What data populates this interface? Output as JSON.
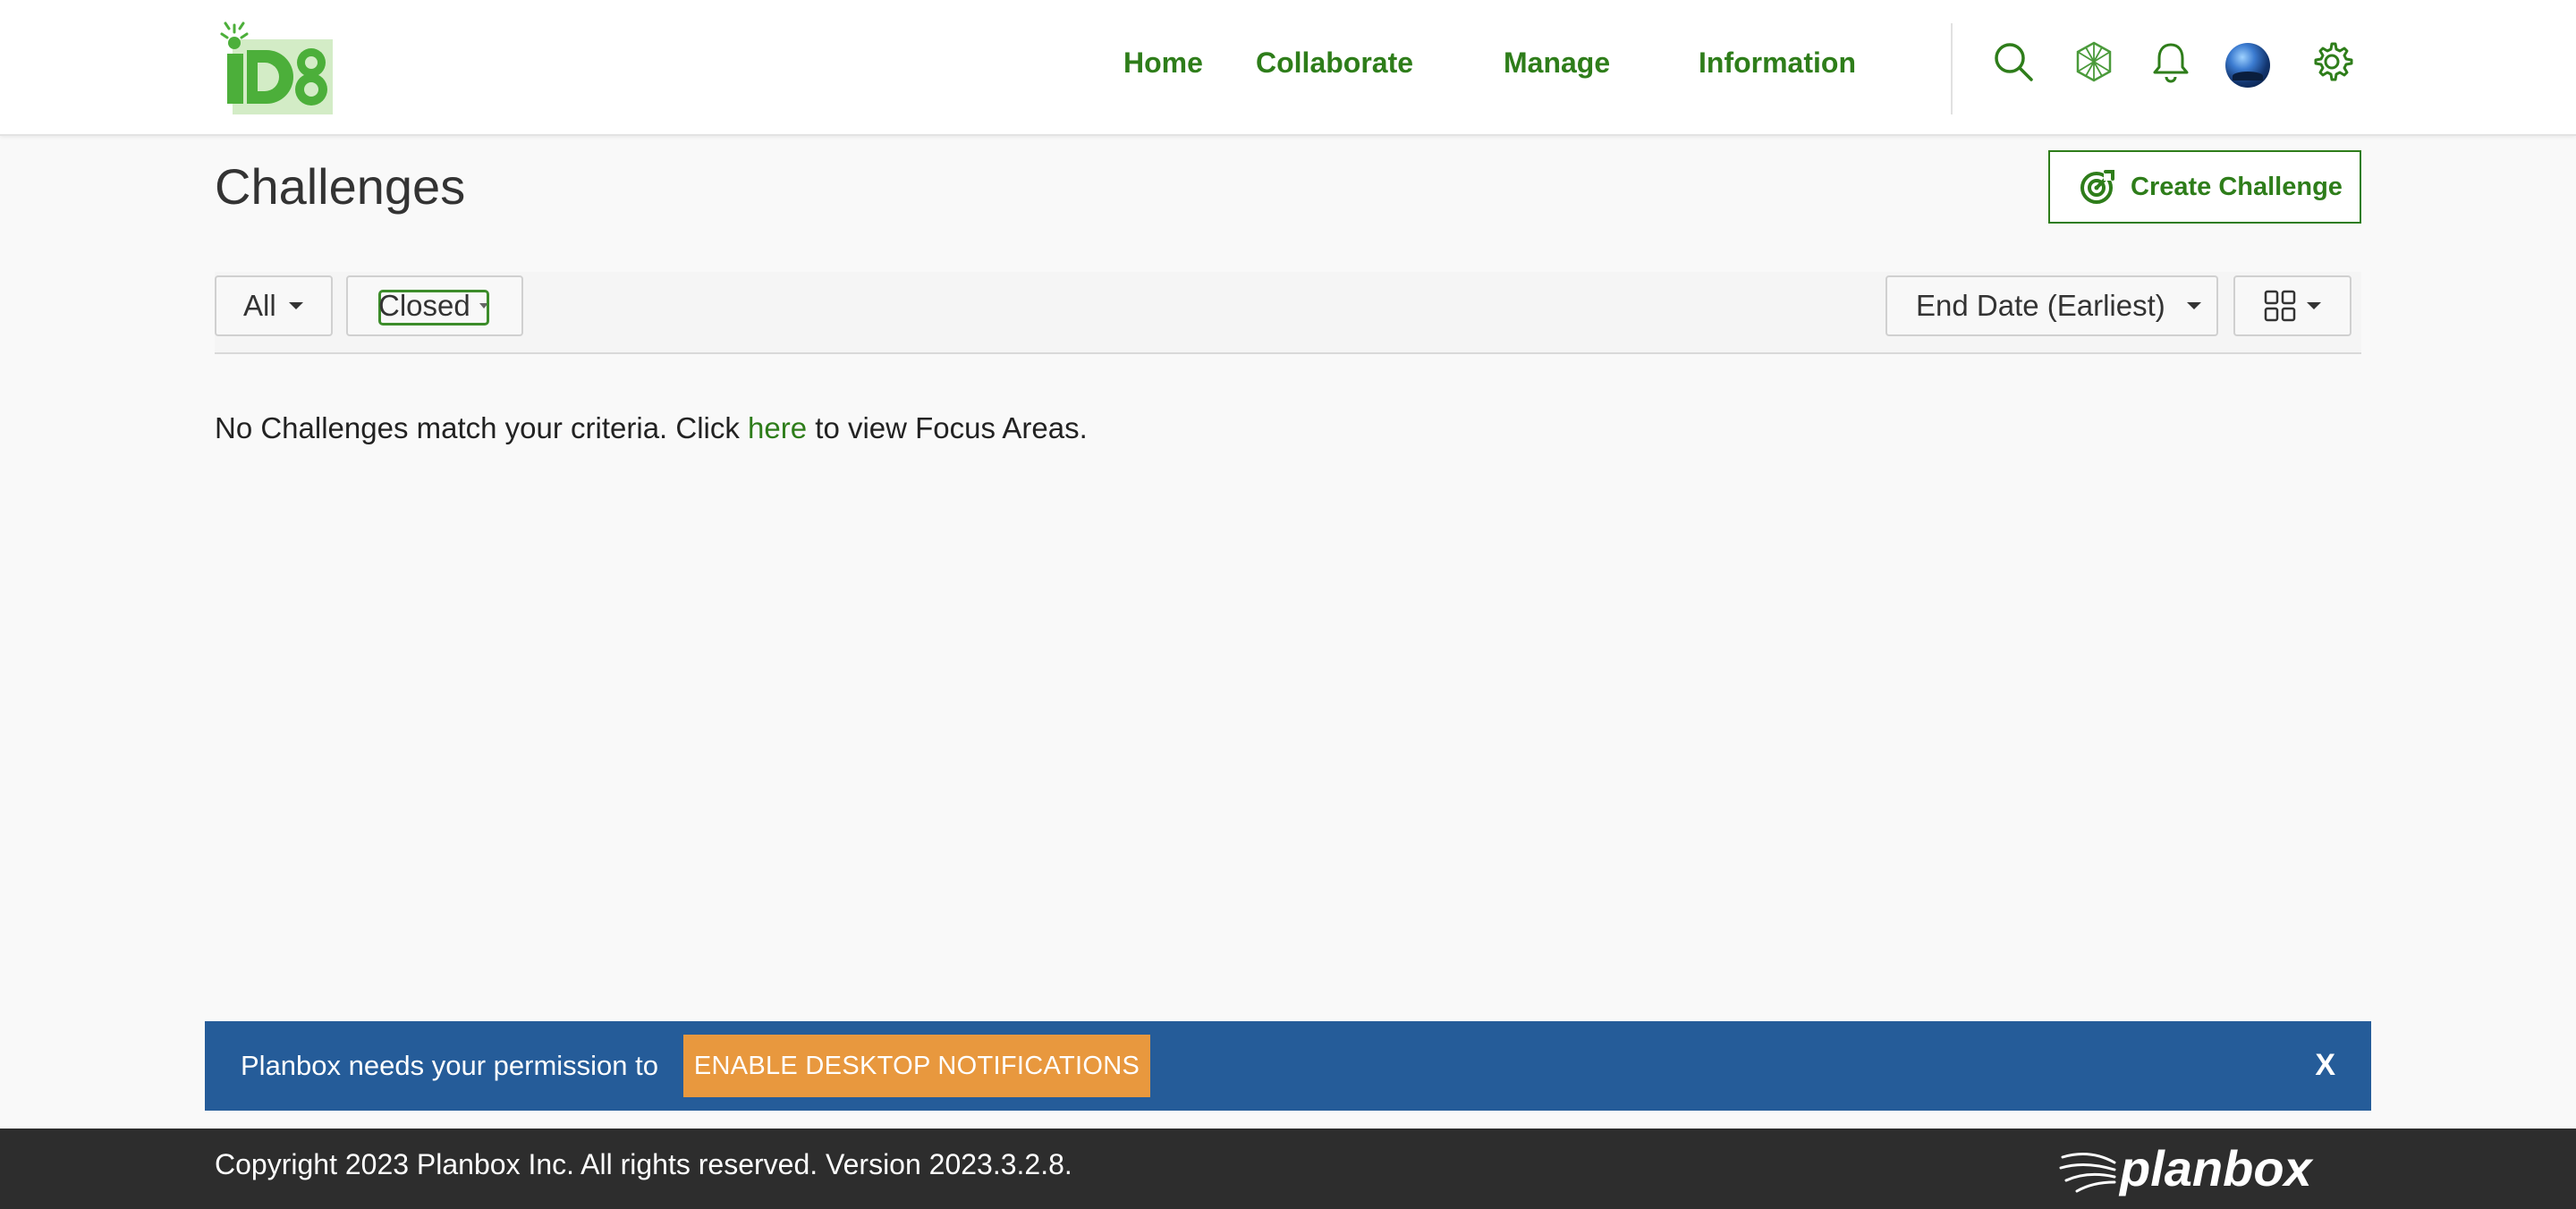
{
  "header": {
    "logo_text": "iD8",
    "nav": [
      {
        "label": "Home"
      },
      {
        "label": "Collaborate"
      },
      {
        "label": "Manage"
      },
      {
        "label": "Information"
      }
    ],
    "icons": [
      "search-icon",
      "hexagon-network-icon",
      "bell-icon",
      "avatar",
      "gear-icon"
    ]
  },
  "page": {
    "title": "Challenges",
    "create_button": "Create Challenge"
  },
  "filters": {
    "scope": "All",
    "status": "Closed",
    "sort": "End Date (Earliest)",
    "view_icon": "grid-view-icon"
  },
  "empty": {
    "before": "No Challenges match your criteria. Click ",
    "link": "here",
    "after": " to view Focus Areas."
  },
  "notification": {
    "message": "Planbox needs your permission to",
    "button": "ENABLE DESKTOP NOTIFICATIONS",
    "close": "X"
  },
  "footer": {
    "copyright": "Copyright 2023 Planbox Inc. All rights reserved. Version 2023.3.2.8.",
    "brand": "planbox"
  },
  "colors": {
    "accent": "#2e7d1a",
    "banner": "#255c99",
    "enable_button": "#e8983e",
    "footer": "#2d2d2d"
  }
}
